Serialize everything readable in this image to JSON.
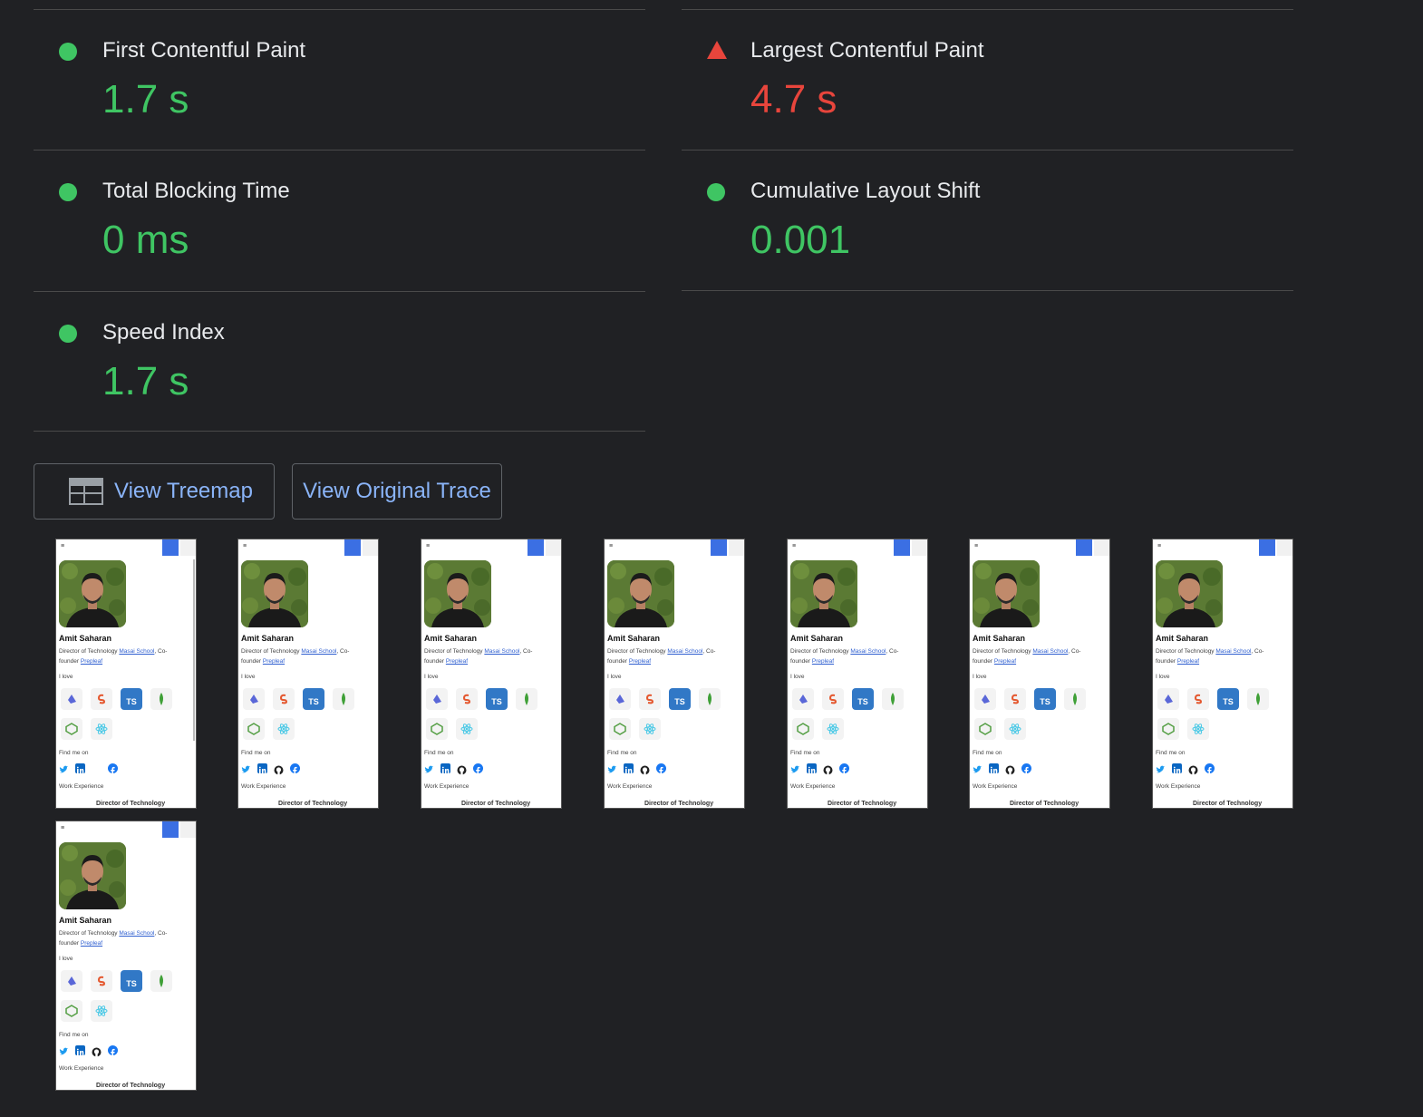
{
  "metrics": [
    {
      "title": "First Contentful Paint",
      "value": "1.7 s",
      "status": "pass"
    },
    {
      "title": "Largest Contentful Paint",
      "value": "4.7 s",
      "status": "fail"
    },
    {
      "title": "Total Blocking Time",
      "value": "0 ms",
      "status": "pass"
    },
    {
      "title": "Cumulative Layout Shift",
      "value": "0.001",
      "status": "pass"
    },
    {
      "title": "Speed Index",
      "value": "1.7 s",
      "status": "pass"
    }
  ],
  "buttons": {
    "treemap_label": "View Treemap",
    "trace_label": "View Original Trace"
  },
  "thumbnail": {
    "name": "Amit Saharan",
    "bio_prefix": "Director of Technology ",
    "bio_link1": "Masai School",
    "bio_mid": ", Co-",
    "bio_line2": "founder ",
    "bio_link2": "Prepleaf",
    "love": "I love",
    "find": "Find me on",
    "work": "Work Experience",
    "role": "Director of Technology",
    "skill_icons": [
      "prisma-icon",
      "svelte-icon",
      "typescript-icon",
      "mongodb-icon",
      "nodejs-icon",
      "react-icon"
    ],
    "social_icons": [
      "twitter-icon",
      "linkedin-icon",
      "github-icon",
      "facebook-icon"
    ],
    "ts_label": "TS"
  },
  "colors": {
    "pass": "#3fc563",
    "fail": "#e8453c",
    "link": "#8ab4f8",
    "background": "#202124"
  }
}
